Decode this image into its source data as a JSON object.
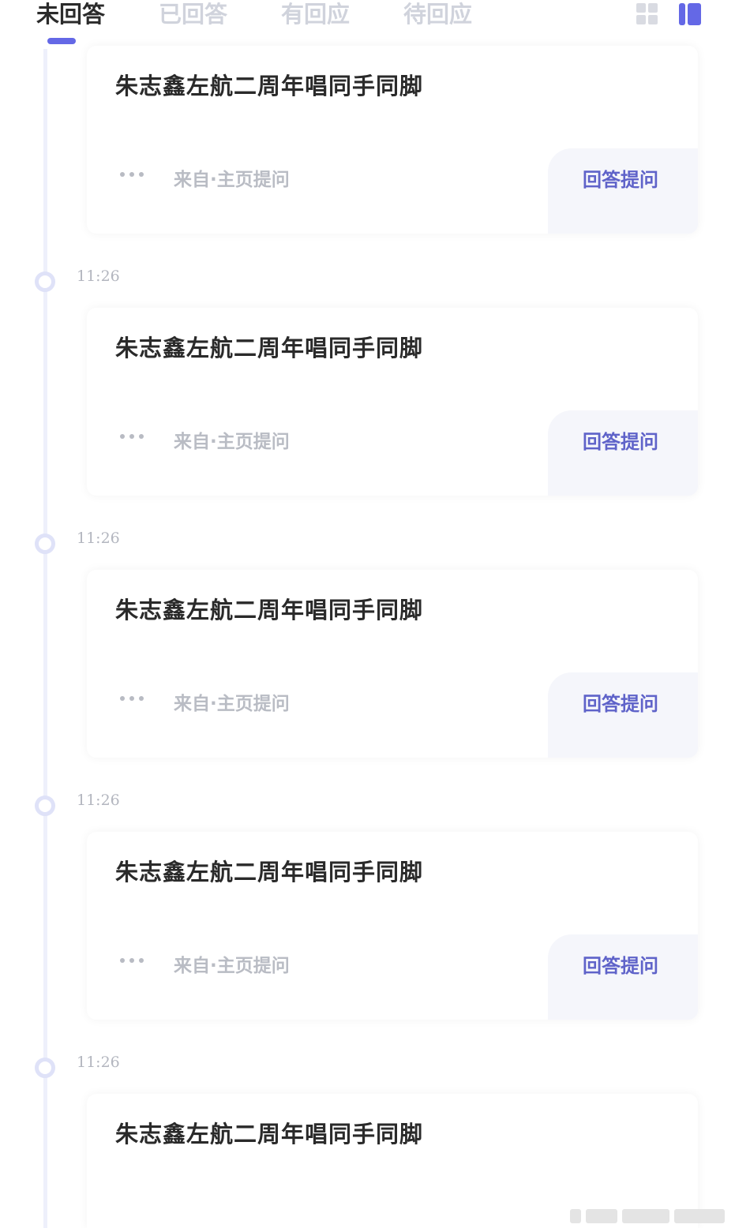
{
  "tabs": [
    {
      "label": "未回答",
      "active": true
    },
    {
      "label": "已回答",
      "active": false
    },
    {
      "label": "有回应",
      "active": false
    },
    {
      "label": "待回应",
      "active": false
    }
  ],
  "view_toggle": {
    "grid_icon": "grid-view-icon",
    "list_icon": "list-view-icon",
    "selected": "list"
  },
  "accent_color": "#6468e6",
  "items": [
    {
      "time": "",
      "title": "朱志鑫左航二周年唱同手同脚",
      "source": "来自·主页提问",
      "answer_label": "回答提问"
    },
    {
      "time": "11:26",
      "title": "朱志鑫左航二周年唱同手同脚",
      "source": "来自·主页提问",
      "answer_label": "回答提问"
    },
    {
      "time": "11:26",
      "title": "朱志鑫左航二周年唱同手同脚",
      "source": "来自·主页提问",
      "answer_label": "回答提问"
    },
    {
      "time": "11:26",
      "title": "朱志鑫左航二周年唱同手同脚",
      "source": "来自·主页提问",
      "answer_label": "回答提问"
    },
    {
      "time": "11:26",
      "title": "朱志鑫左航二周年唱同手同脚",
      "source": "",
      "answer_label": ""
    }
  ]
}
